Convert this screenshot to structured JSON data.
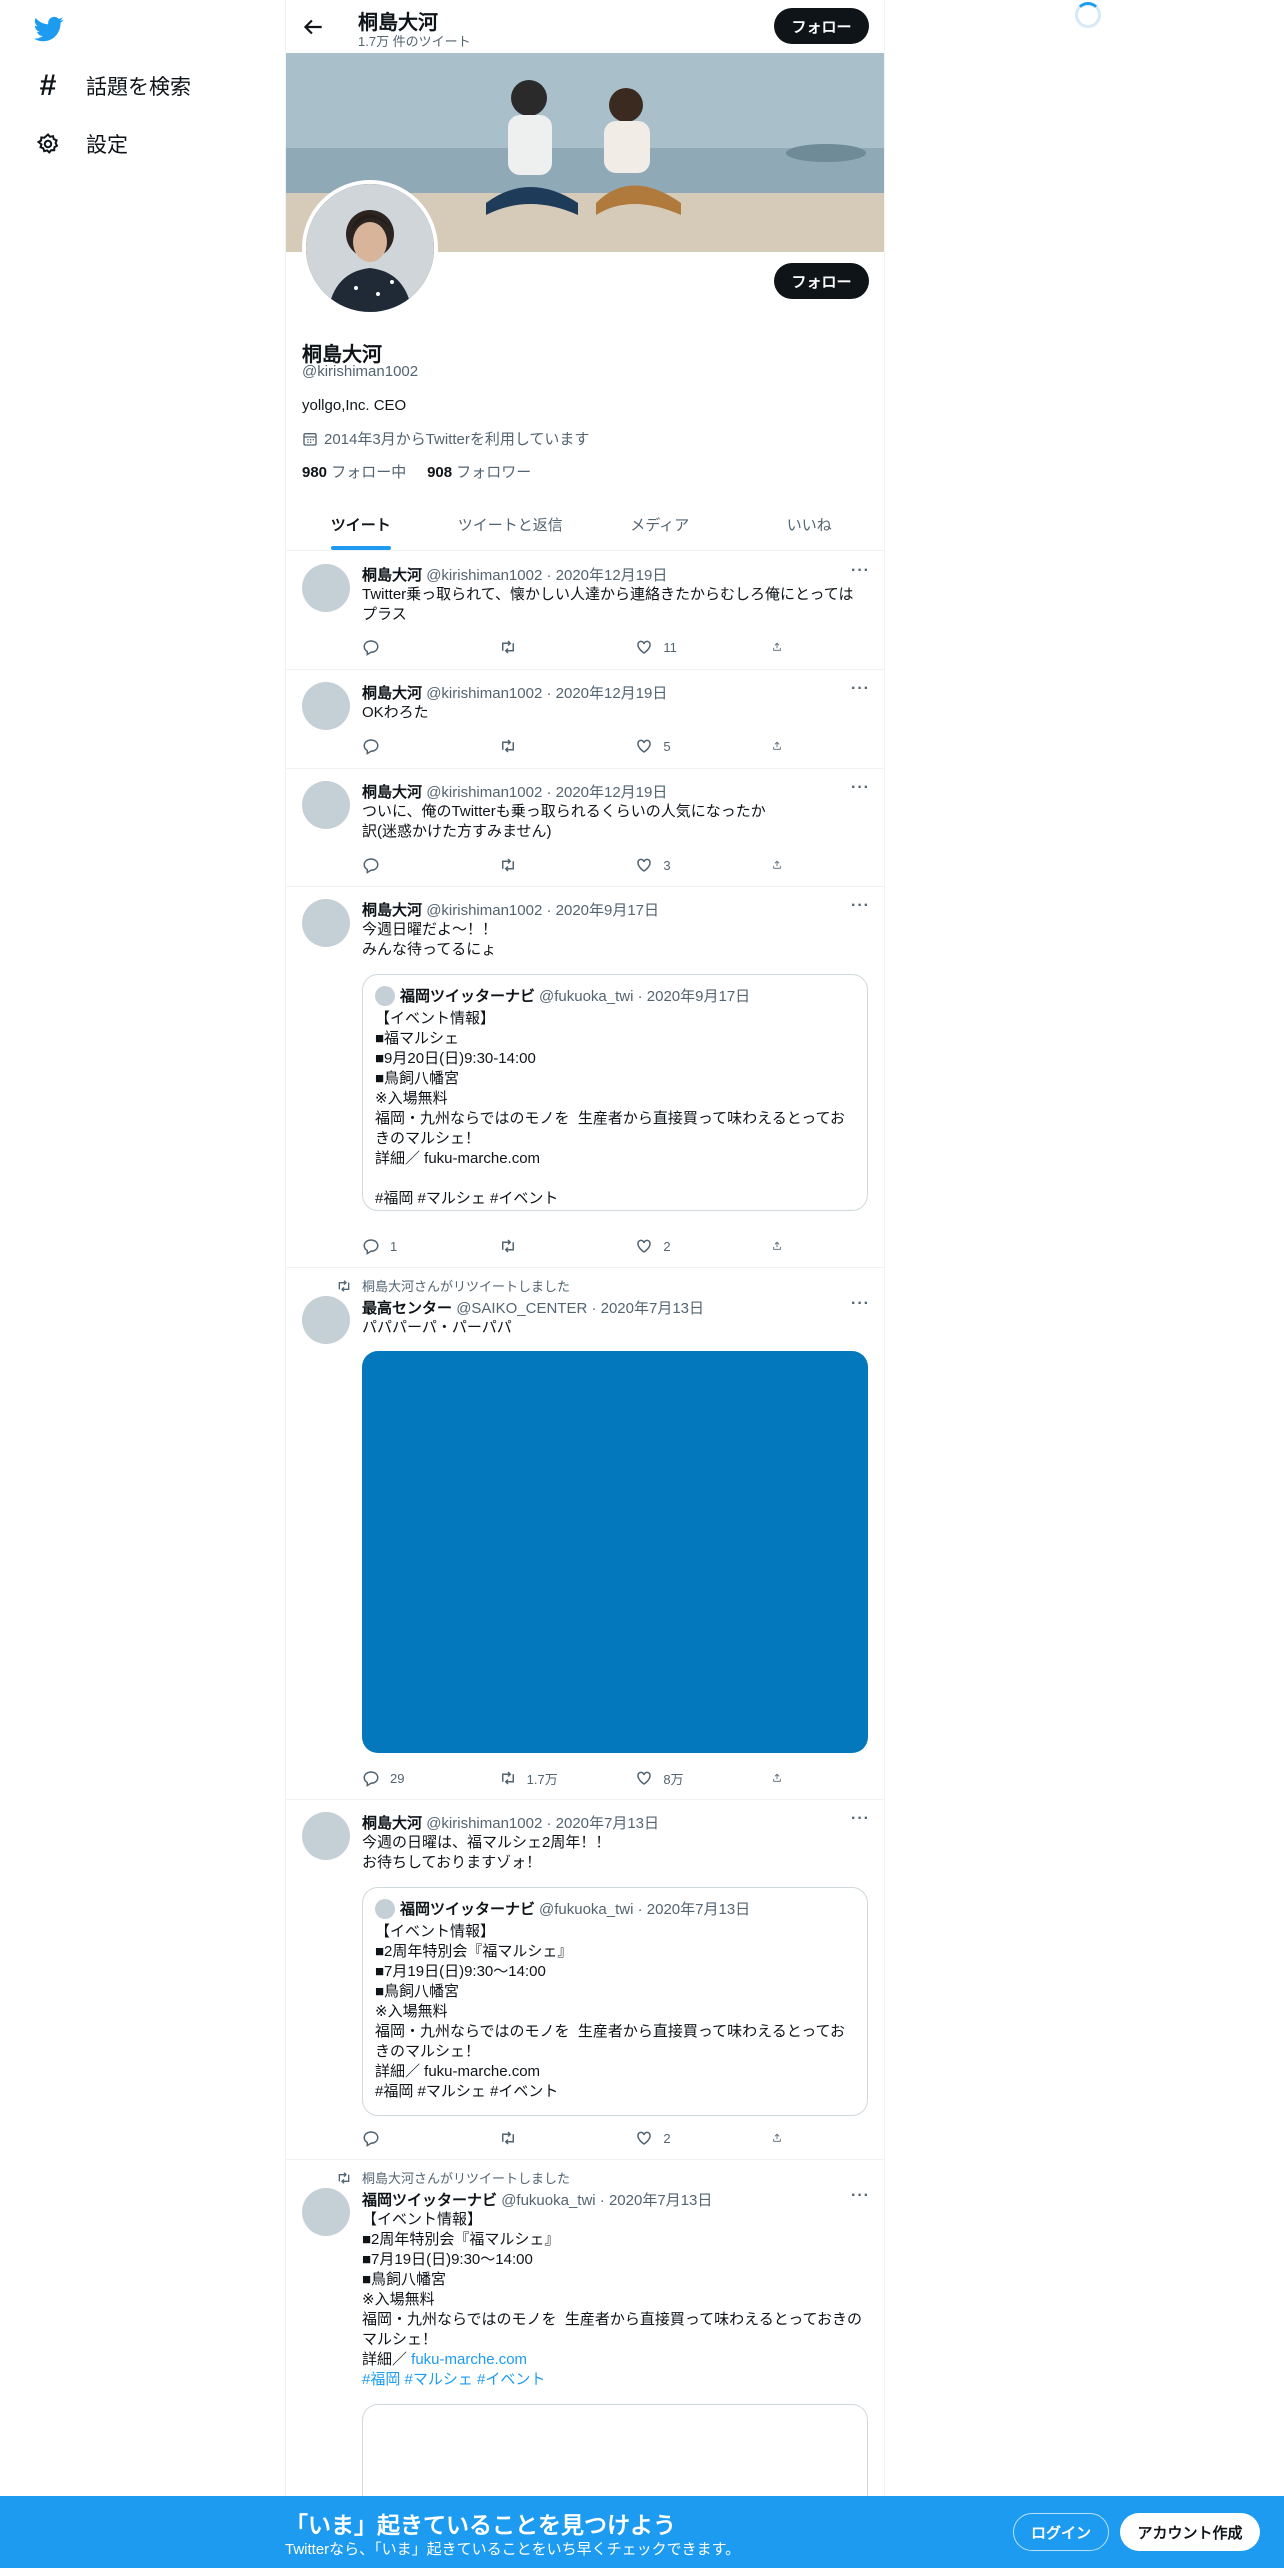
{
  "brand": {
    "accent": "#1d9bf0",
    "dark": "#0f1419",
    "muted": "#536471",
    "logo_icon": "twitter-bird-icon"
  },
  "sidebar": {
    "items": [
      {
        "icon": "hashtag-icon",
        "label": "話題を検索"
      },
      {
        "icon": "gear-icon",
        "label": "設定"
      }
    ]
  },
  "header": {
    "name": "桐島大河",
    "tweet_count": "1.7万 件のツイート",
    "follow_label": "フォロー"
  },
  "profile": {
    "name": "桐島大河",
    "handle": "@kirishiman1002",
    "bio": "yollgo,Inc. CEO",
    "joined": "2014年3月からTwitterを利用しています",
    "following_count": "980",
    "following_label": "フォロー中",
    "followers_count": "908",
    "followers_label": "フォロワー",
    "follow_label": "フォロー"
  },
  "tabs": [
    "ツイート",
    "ツイートと返信",
    "メディア",
    "いいね"
  ],
  "tweets": [
    {
      "name": "桐島大河",
      "meta": "@kirishiman1002 · 2020年12月19日",
      "text": "Twitter乗っ取られて、懐かしい人達から連絡きたからむしろ俺にとってはプラス",
      "replies": "",
      "retweets": "",
      "likes": "11"
    },
    {
      "name": "桐島大河",
      "meta": "@kirishiman1002 · 2020年12月19日",
      "text": "OKわろた",
      "replies": "",
      "retweets": "",
      "likes": "5"
    },
    {
      "name": "桐島大河",
      "meta": "@kirishiman1002 · 2020年12月19日",
      "text": "ついに、俺のTwitterも乗っ取られるくらいの人気になったか\n訳(迷惑かけた方すみません)",
      "replies": "",
      "retweets": "",
      "likes": "3"
    },
    {
      "name": "桐島大河",
      "meta": "@kirishiman1002 · 2020年9月17日",
      "text": "今週日曜だよ〜！！\nみんな待ってるにょ",
      "quote": {
        "name": "福岡ツイッターナビ",
        "meta": "@fukuoka_twi · 2020年9月17日",
        "text": "【イベント情報】\n■福マルシェ\n■9月20日(日)9:30-14:00\n■鳥飼八幡宮\n※入場無料\n福岡・九州ならではのモノを  生産者から直接買って味わえるとっておきのマルシェ！\n詳細／ fuku-marche.com\n\n#福岡 #マルシェ #イベント"
      },
      "replies": "1",
      "retweets": "",
      "likes": "2"
    },
    {
      "retweet_label": "桐島大河さんがリツイートしました",
      "name": "最高センター",
      "meta": "@SAIKO_CENTER · 2020年7月13日",
      "text": "パパパーパ・パーパパ",
      "media_color": "#0478bd",
      "replies": "29",
      "retweets": "1.7万",
      "likes": "8万"
    },
    {
      "name": "桐島大河",
      "meta": "@kirishiman1002 · 2020年7月13日",
      "text": "今週の日曜は、福マルシェ2周年！！\nお待ちしておりますゾォ！",
      "quote": {
        "name": "福岡ツイッターナビ",
        "meta": "@fukuoka_twi · 2020年7月13日",
        "text": "【イベント情報】\n■2周年特別会『福マルシェ』\n■7月19日(日)9:30〜14:00\n■鳥飼八幡宮\n※入場無料\n福岡・九州ならではのモノを  生産者から直接買って味わえるとっておきのマルシェ！\n詳細／ fuku-marche.com\n#福岡 #マルシェ #イベント"
      },
      "replies": "",
      "retweets": "",
      "likes": "2"
    },
    {
      "retweet_label": "桐島大河さんがリツイートしました",
      "name": "福岡ツイッターナビ",
      "meta": "@fukuoka_twi · 2020年7月13日",
      "text": "【イベント情報】\n■2周年特別会『福マルシェ』\n■7月19日(日)9:30〜14:00\n■鳥飼八幡宮\n※入場無料\n福岡・九州ならではのモノを  生産者から直接買って味わえるとっておきのマルシェ！",
      "detail_prefix": "詳細／ ",
      "detail_link": "fuku-marche.com",
      "hashtags": "#福岡 #マルシェ #イベント"
    }
  ],
  "bottom_bar": {
    "title": "「いま」起きていることを見つけよう",
    "subtitle": "Twitterなら、「いま」起きていることをいち早くチェックできます。",
    "login_label": "ログイン",
    "signup_label": "アカウント作成"
  }
}
